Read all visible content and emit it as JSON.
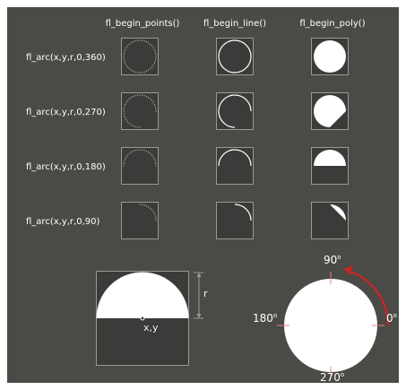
{
  "headers": {
    "points": "fl_begin_points()",
    "line": "fl_begin_line()",
    "poly": "fl_begin_poly()"
  },
  "rows": [
    {
      "label": "fl_arc(x,y,r,0,360)",
      "sweep": 360
    },
    {
      "label": "fl_arc(x,y,r,0,270)",
      "sweep": 270
    },
    {
      "label": "fl_arc(x,y,r,0,180)",
      "sweep": 180
    },
    {
      "label": "fl_arc(x,y,r,0,90)",
      "sweep": 90
    }
  ],
  "bottom_left": {
    "r_label": "r",
    "center_label": "x,y"
  },
  "angles": {
    "deg_90": "90",
    "deg_180": "180",
    "deg_0": "0",
    "deg_270": "270",
    "degree_symbol": "o"
  },
  "colors": {
    "background": "#4a4a46",
    "cell": "#3b3b39",
    "shape": "#ffffff",
    "arrow": "#c0282a",
    "tick": "#e08080"
  }
}
